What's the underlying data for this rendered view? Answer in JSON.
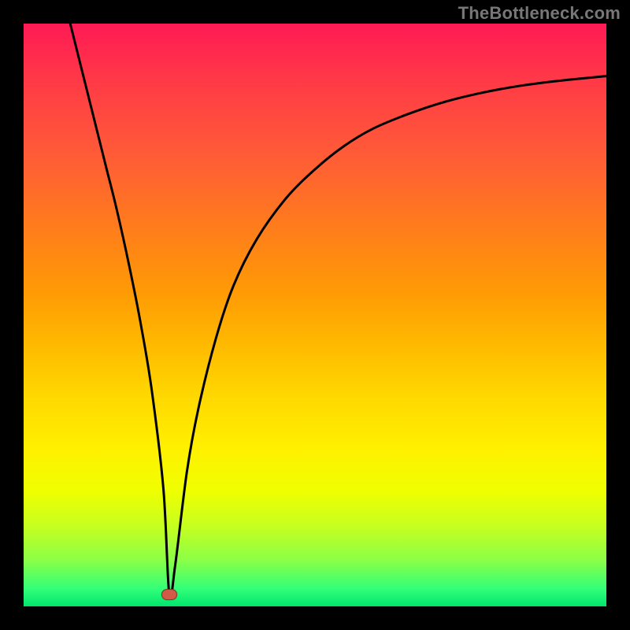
{
  "watermark": "TheBottleneck.com",
  "chart_data": {
    "type": "line",
    "title": "",
    "xlabel": "",
    "ylabel": "",
    "xlim": [
      0,
      100
    ],
    "ylim": [
      0,
      100
    ],
    "grid": false,
    "legend": false,
    "series": [
      {
        "name": "curve",
        "x": [
          8,
          10,
          12,
          14,
          16,
          18,
          20,
          22,
          24,
          25,
          26,
          28,
          30,
          33,
          36,
          40,
          45,
          50,
          55,
          60,
          66,
          72,
          78,
          85,
          92,
          100
        ],
        "y": [
          100,
          92,
          84,
          76,
          68,
          59,
          49,
          37,
          20,
          2,
          7,
          23,
          34,
          46,
          55,
          63,
          70,
          75,
          79,
          82,
          84.5,
          86.5,
          88,
          89.3,
          90.2,
          91
        ]
      }
    ],
    "marker": {
      "x": 25,
      "y": 2,
      "color": "#d25a46"
    },
    "background_gradient": {
      "top": "#ff1a55",
      "bottom": "#00e56e"
    }
  }
}
